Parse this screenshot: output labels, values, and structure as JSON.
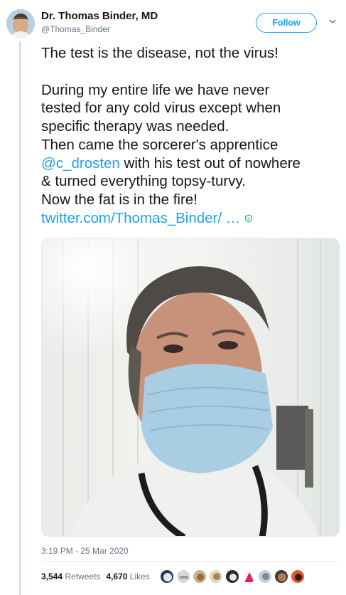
{
  "author": {
    "name": "Dr. Thomas Binder, MD",
    "handle": "@Thomas_Binder"
  },
  "follow_label": "Follow",
  "tweet": {
    "line1": "The test is the disease, not the virus!",
    "line2": "During my entire life we have never",
    "line3": "tested for any cold virus except when",
    "line4": "specific therapy was needed.",
    "line5": "Then came the sorcerer's apprentice",
    "mention": "@c_drosten",
    "line6_rest": " with his test out of nowhere",
    "line7": "& turned everything topsy-turvy.",
    "line8": "Now the fat is in the fire!",
    "link": "twitter.com/Thomas_Binder/ …"
  },
  "timestamp": "3:19 PM - 25 Mar 2020",
  "stats": {
    "retweets_count": "3,544",
    "retweets_label": "Retweets",
    "likes_count": "4,670",
    "likes_label": "Likes"
  },
  "colors": {
    "accent": "#1da1f2",
    "text": "#14171a",
    "muted": "#657786"
  }
}
